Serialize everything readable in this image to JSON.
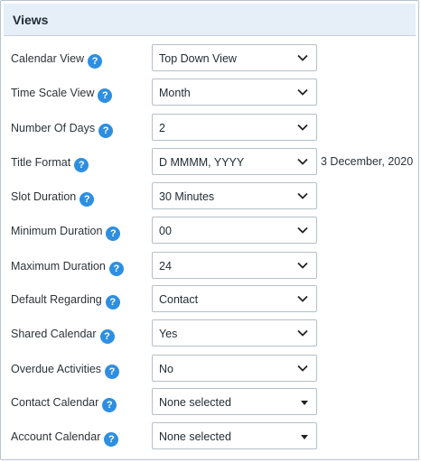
{
  "panel": {
    "title": "Views"
  },
  "help_glyph": "?",
  "rows": [
    {
      "label": "Calendar View",
      "value": "Top Down View"
    },
    {
      "label": "Time Scale View",
      "value": "Month"
    },
    {
      "label": "Number Of Days",
      "value": "2"
    },
    {
      "label": "Title Format",
      "value": "D MMMM, YYYY",
      "preview": "3 December, 2020"
    },
    {
      "label": "Slot Duration",
      "value": "30 Minutes"
    },
    {
      "label": "Minimum Duration",
      "value": "00"
    },
    {
      "label": "Maximum Duration",
      "value": "24"
    },
    {
      "label": "Default Regarding",
      "value": "Contact"
    },
    {
      "label": "Shared Calendar",
      "value": "Yes"
    },
    {
      "label": "Overdue Activities",
      "value": "No"
    },
    {
      "label": "Contact Calendar",
      "value": "None selected"
    },
    {
      "label": "Account Calendar",
      "value": "None selected"
    }
  ],
  "colors": {
    "header_bg": "#e6eef8",
    "help_icon": "#2e8fe0",
    "border": "#b7bfc6"
  }
}
